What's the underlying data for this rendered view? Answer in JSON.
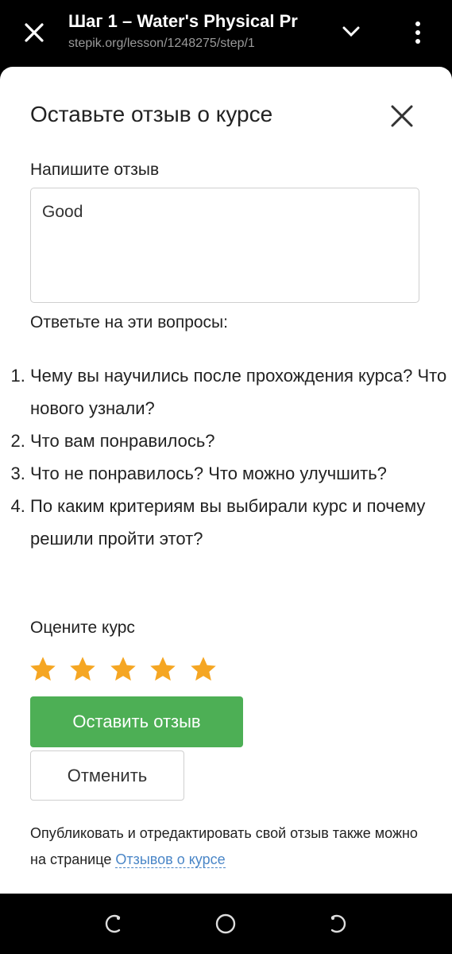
{
  "browser": {
    "tab_title": "Шаг 1 – Water's Physical Pr",
    "url": "stepik.org/lesson/1248275/step/1"
  },
  "dialog": {
    "title": "Оставьте отзыв о курсе",
    "review_label": "Напишите отзыв",
    "review_value": "Good",
    "questions_label": "Ответьте на эти вопросы:",
    "questions": [
      "Чему вы научились после прохождения курса? Что нового узнали?",
      "Что вам понравилось?",
      "Что не понравилось? Что можно улучшить?",
      "По каким критериям вы выбирали курс и почему решили пройти этот?"
    ],
    "rating_label": "Оцените курс",
    "rating": 5,
    "rating_max": 5,
    "submit_label": "Оставить отзыв",
    "cancel_label": "Отменить",
    "footer_text": "Опубликовать и отредактировать свой отзыв также можно на странице ",
    "footer_link": "Отзывов о курсе"
  },
  "colors": {
    "accent_green": "#4daf55",
    "star": "#f5a623",
    "link": "#4a86c7"
  }
}
